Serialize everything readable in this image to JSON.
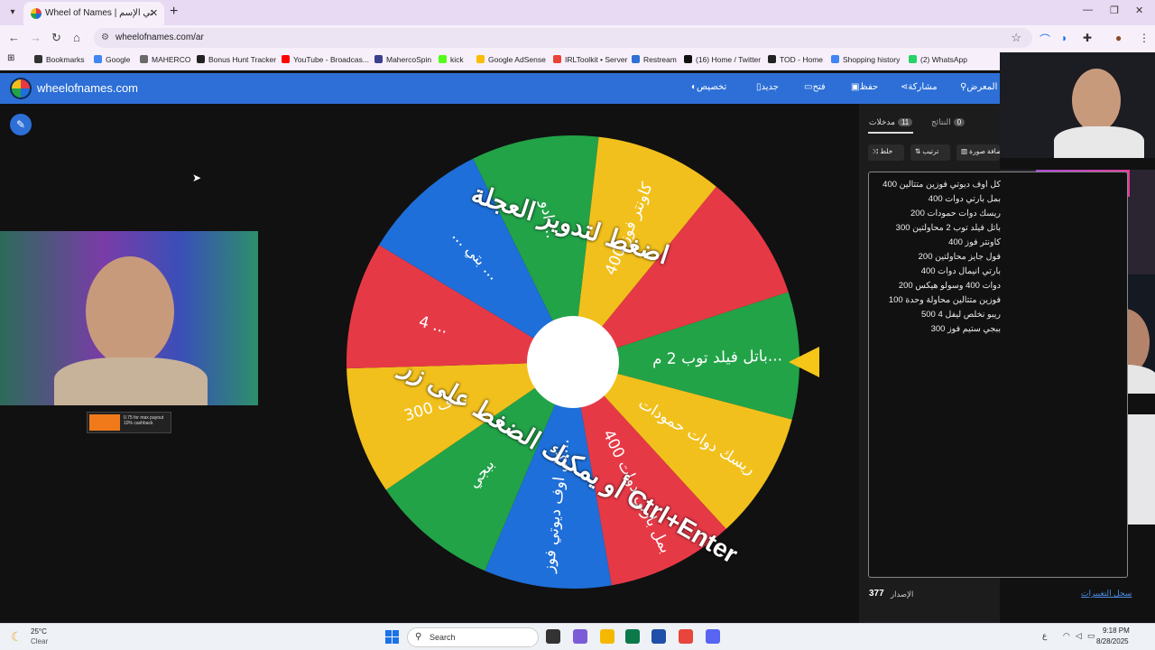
{
  "browser": {
    "tab_title": "Wheel of Names | العشوائي الإسم",
    "tab_close": "✕",
    "new_tab": "+",
    "url": "wheelofnames.com/ar",
    "window_controls": [
      "—",
      "❐",
      "✕"
    ]
  },
  "bookmarks": [
    {
      "label": "Bookmarks",
      "color": "#333333"
    },
    {
      "label": "Google",
      "color": "#4285f4"
    },
    {
      "label": "MAHERCO",
      "color": "#6a6a6a"
    },
    {
      "label": "Bonus Hunt Tracker",
      "color": "#222222"
    },
    {
      "label": "YouTube - Broadcas...",
      "color": "#ff0000"
    },
    {
      "label": "MahercoSpin",
      "color": "#3b3f8f"
    },
    {
      "label": "kick",
      "color": "#53fc18"
    },
    {
      "label": "Google AdSense",
      "color": "#fbbc04"
    },
    {
      "label": "IRLToolkit • Server",
      "color": "#ea4335"
    },
    {
      "label": "Restream",
      "color": "#2f6fd6"
    },
    {
      "label": "(16) Home / Twitter",
      "color": "#111111"
    },
    {
      "label": "TOD - Home",
      "color": "#222222"
    },
    {
      "label": "Shopping history",
      "color": "#4285f4"
    },
    {
      "label": "(2) WhatsApp",
      "color": "#25d366"
    }
  ],
  "site": {
    "title": "wheelofnames.com",
    "menu": [
      {
        "label": "المعرض",
        "icon": "search-icon",
        "glyph": "⚲"
      },
      {
        "label": "مشاركة",
        "icon": "share-icon",
        "glyph": "⋖"
      },
      {
        "label": "حفظ",
        "icon": "save-icon",
        "glyph": "▣"
      },
      {
        "label": "فتح",
        "icon": "folder-icon",
        "glyph": "▭"
      },
      {
        "label": "جديد",
        "icon": "new-file-icon",
        "glyph": "▯"
      },
      {
        "label": "تخصيص",
        "icon": "palette-icon",
        "glyph": "◐"
      }
    ],
    "accent": "#2d6fd6"
  },
  "wheel": {
    "colors": [
      "#22a348",
      "#f2c01d",
      "#e63946",
      "#1e6fd9"
    ],
    "spin_hint_top": "اضغط لتدوير العجلة",
    "spin_hint_bottom": "أو يمكنك الضغط على زر Ctrl+Enter",
    "segments": [
      "باتل فيلد توب 2 م...",
      "ريسك دوات حمودات",
      "بمل بارتي دوات 400",
      "كل اوف ديوتي فوز...",
      "ببجي",
      "300 ف...",
      "4 ...",
      "... بتي ...",
      "ادو ...",
      "كاونتر فوز 400"
    ]
  },
  "panel": {
    "tabs": [
      {
        "label": "مدخلات",
        "count": "11"
      },
      {
        "label": "النتائج",
        "count": "0"
      }
    ],
    "buttons": [
      "خلط",
      "ترتيب",
      "إضافة صورة"
    ],
    "entries": [
      "كل اوف ديوتي فوزين متتالين 400",
      "بمل بارتي دوات 400",
      "ريسك دوات حمودات 200",
      "باتل فيلد توب 2 محاولتين 300",
      "كاونتر فوز 400",
      "فول جايز محاولتين 200",
      "بارتي انيمال دوات 400",
      "دوات 400 وسولو هيكس 200",
      "فوزين متتالين محاولة وحدة 100",
      "ريبو نخلص ليفل 4 500",
      "ببجي ستيم فوز 300"
    ],
    "version_label": "الإصدار",
    "version": "377",
    "changelog": "سجل التغييرات"
  },
  "promo": {
    "text": "0.75 for max payout 10% cashback"
  },
  "taskbar": {
    "temperature": "25°C",
    "weather": "Clear",
    "search_label": "Search",
    "time": "9:18 PM",
    "date": "8/28/2025",
    "app_colors": [
      "#333333",
      "#7b5cd6",
      "#f5b800",
      "#0b7a4b",
      "#1f4fa8",
      "#e8453c",
      "#5865f2"
    ]
  }
}
